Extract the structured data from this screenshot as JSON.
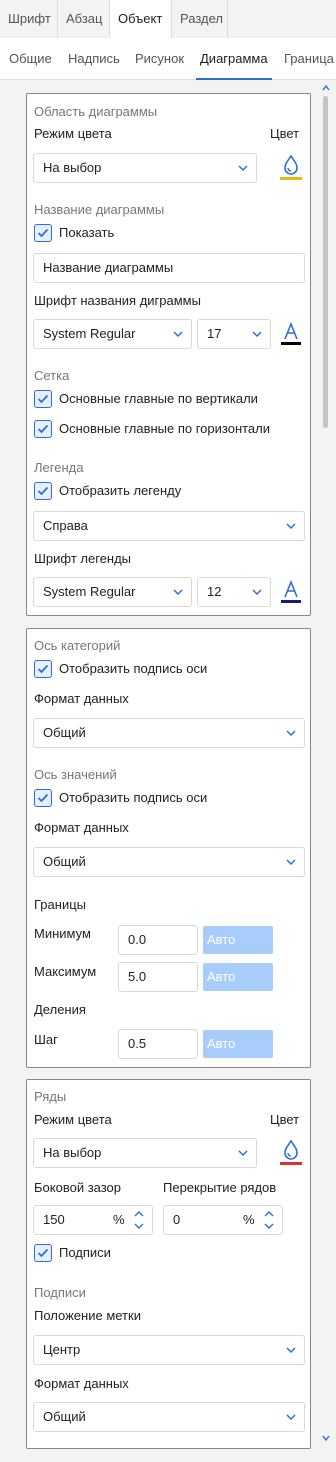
{
  "tabs_top": [
    "Шрифт",
    "Абзац",
    "Объект",
    "Раздел"
  ],
  "tabs_sub": [
    "Общие",
    "Надпись",
    "Рисунок",
    "Диаграмма",
    "Граница"
  ],
  "chart_area": {
    "title": "Область диаграммы",
    "color_mode_label": "Режим цвета",
    "color_label": "Цвет",
    "color_mode_value": "На выбор",
    "color_underline": "#f2b705",
    "name_section": "Название диаграммы",
    "show_label": "Показать",
    "name_value": "Название диаграммы",
    "name_font_label": "Шрифт названия диграммы",
    "name_font_value": "System Regular",
    "name_font_size": "17",
    "name_font_color": "#000000",
    "grid_section": "Сетка",
    "grid_vertical": "Основные главные по вертикали",
    "grid_horizontal": "Основные главные по горизонтали",
    "legend_section": "Легенда",
    "show_legend": "Отобразить легенду",
    "legend_position": "Справа",
    "legend_font_label": "Шрифт легенды",
    "legend_font_value": "System Regular",
    "legend_font_size": "12",
    "legend_font_color": "#1a1a7a"
  },
  "axes": {
    "category_section": "Ось категорий",
    "category_show": "Отобразить подпись оси",
    "category_format_label": "Формат данных",
    "category_format_value": "Общий",
    "value_section": "Ось значений",
    "value_show": "Отобразить подпись оси",
    "value_format_label": "Формат данных",
    "value_format_value": "Общий",
    "bounds_label": "Границы",
    "min_label": "Минимум",
    "min_value": "0.0",
    "max_label": "Максимум",
    "max_value": "5.0",
    "auto_label": "Авто",
    "divisions_label": "Деления",
    "step_label": "Шаг",
    "step_value": "0.5"
  },
  "series": {
    "title": "Ряды",
    "color_mode_label": "Режим цвета",
    "color_label": "Цвет",
    "color_mode_value": "На выбор",
    "color_underline": "#e0312b",
    "gap_label": "Боковой зазор",
    "gap_value": "150",
    "overlap_label": "Перекрытие рядов",
    "overlap_value": "0",
    "percent": "%",
    "labels_check": "Подписи",
    "labels_section": "Подписи",
    "label_position_label": "Положение метки",
    "label_position_value": "Центр",
    "format_label": "Формат данных",
    "format_value": "Общий"
  },
  "accent": "#2b6fd6"
}
